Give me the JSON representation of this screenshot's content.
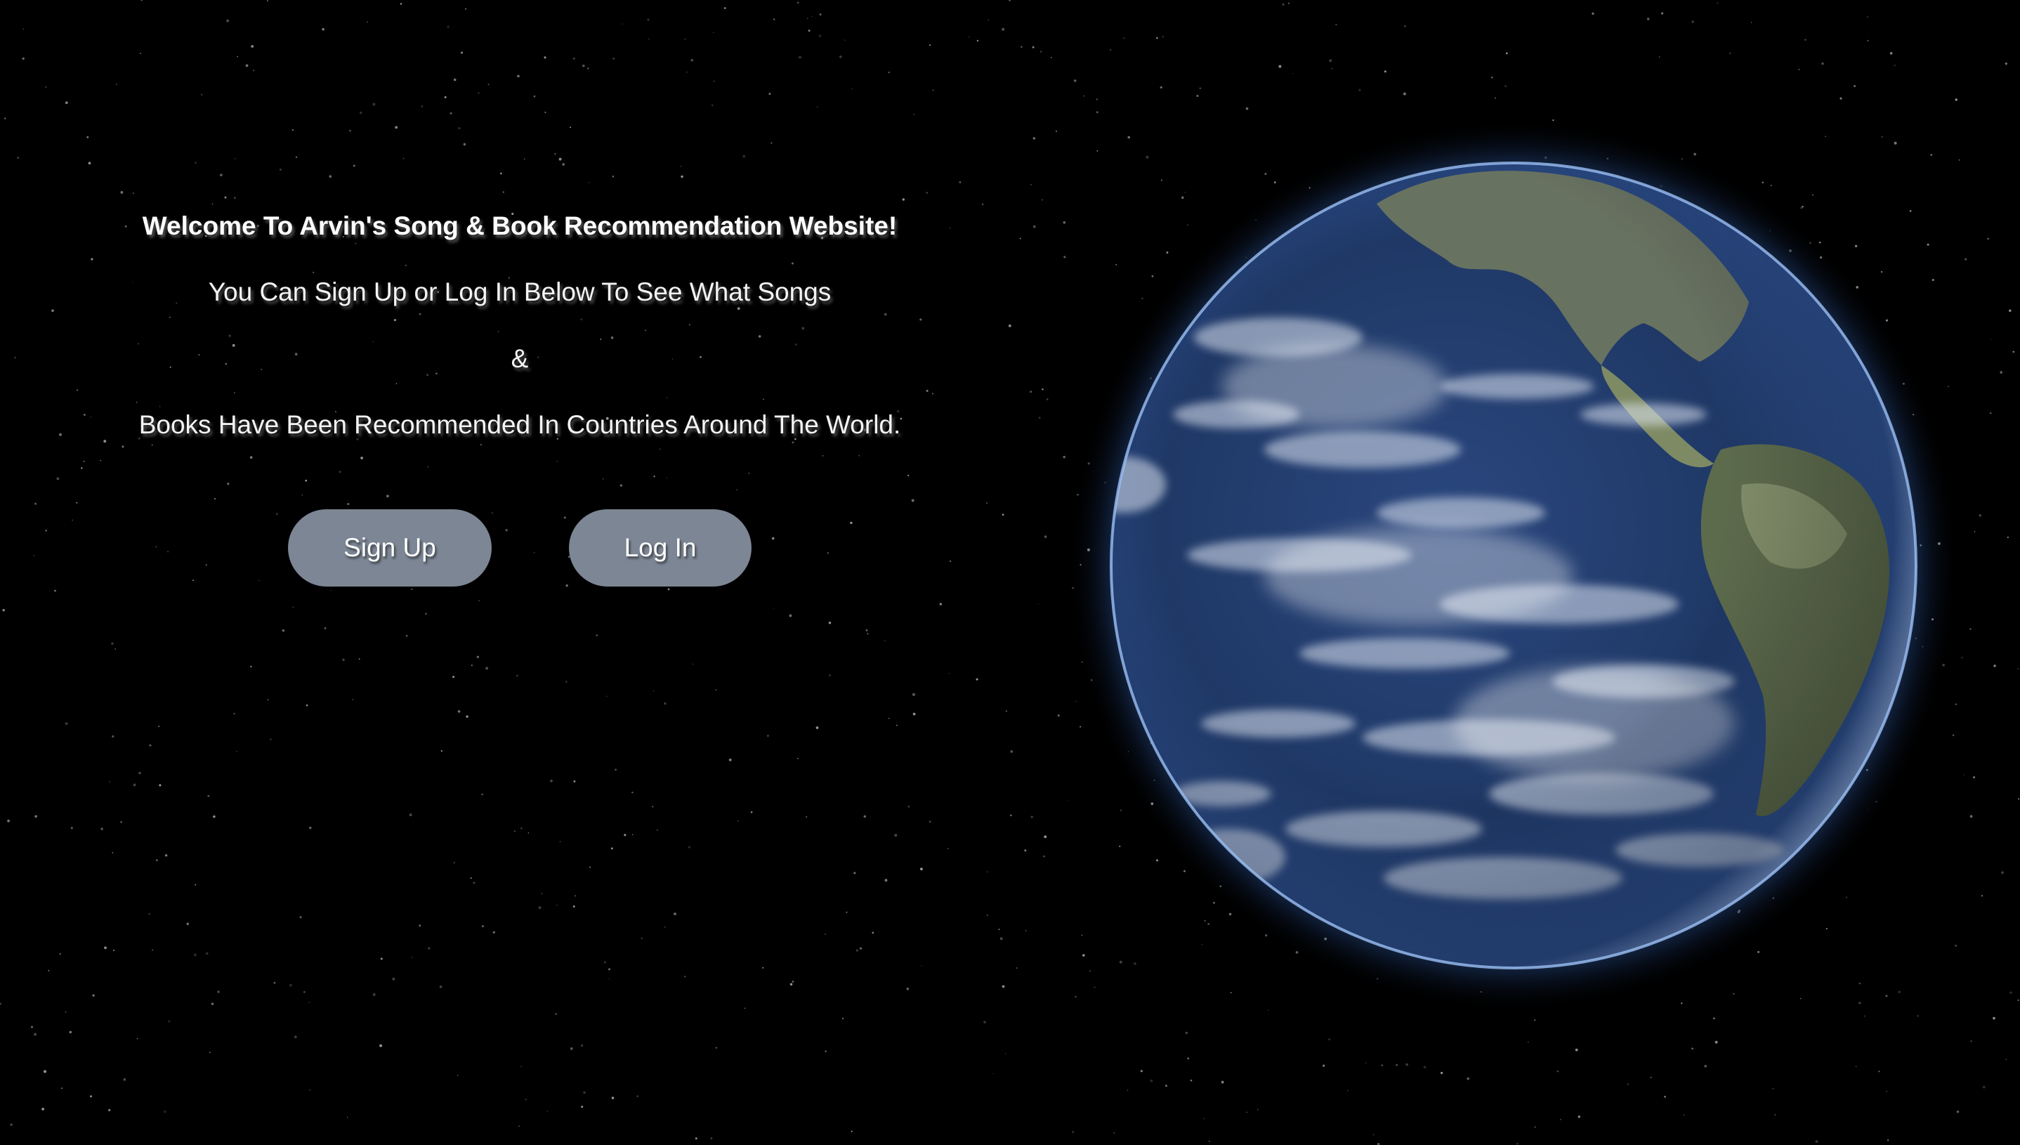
{
  "intro": {
    "headline": "Welcome To Arvin's Song & Book Recommendation Website!",
    "line1": "You Can Sign Up or Log In Below To See What Songs",
    "line2": "&",
    "line3": "Books Have Been Recommended In Countries Around The World."
  },
  "buttons": {
    "signup_label": "Sign Up",
    "login_label": "Log In"
  },
  "colors": {
    "background": "#000000",
    "button": "#7c8694",
    "text": "#ffffff",
    "atmosphere": "#4a7fd8",
    "ocean": "#1d3560"
  },
  "icons": {
    "globe": "earth-globe-image",
    "background": "starfield"
  }
}
